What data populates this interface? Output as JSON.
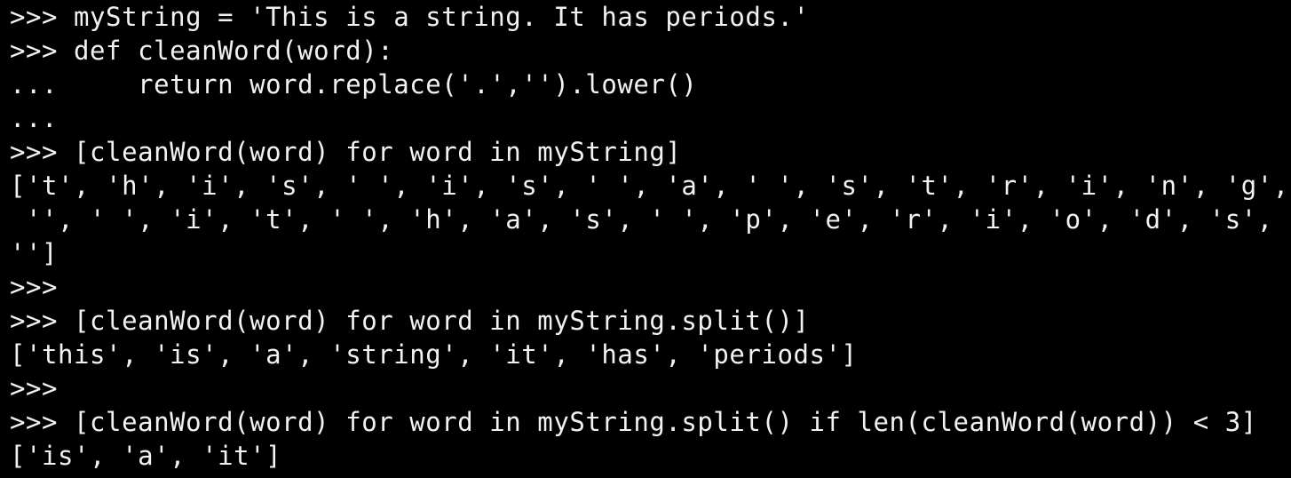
{
  "terminal": {
    "background": "#000000",
    "foreground": "#f2f2f2",
    "lines": [
      ">>> myString = 'This is a string. It has periods.'",
      ">>> def cleanWord(word):",
      "...     return word.replace('.','').lower()",
      "...",
      ">>> [cleanWord(word) for word in myString]",
      "['t', 'h', 'i', 's', ' ', 'i', 's', ' ', 'a', ' ', 's', 't', 'r', 'i', 'n', 'g',",
      " '', ' ', 'i', 't', ' ', 'h', 'a', 's', ' ', 'p', 'e', 'r', 'i', 'o', 'd', 's',",
      "'']",
      ">>>",
      ">>> [cleanWord(word) for word in myString.split()]",
      "['this', 'is', 'a', 'string', 'it', 'has', 'periods']",
      ">>>",
      ">>> [cleanWord(word) for word in myString.split() if len(cleanWord(word)) < 3]",
      "['is', 'a', 'it']"
    ]
  }
}
